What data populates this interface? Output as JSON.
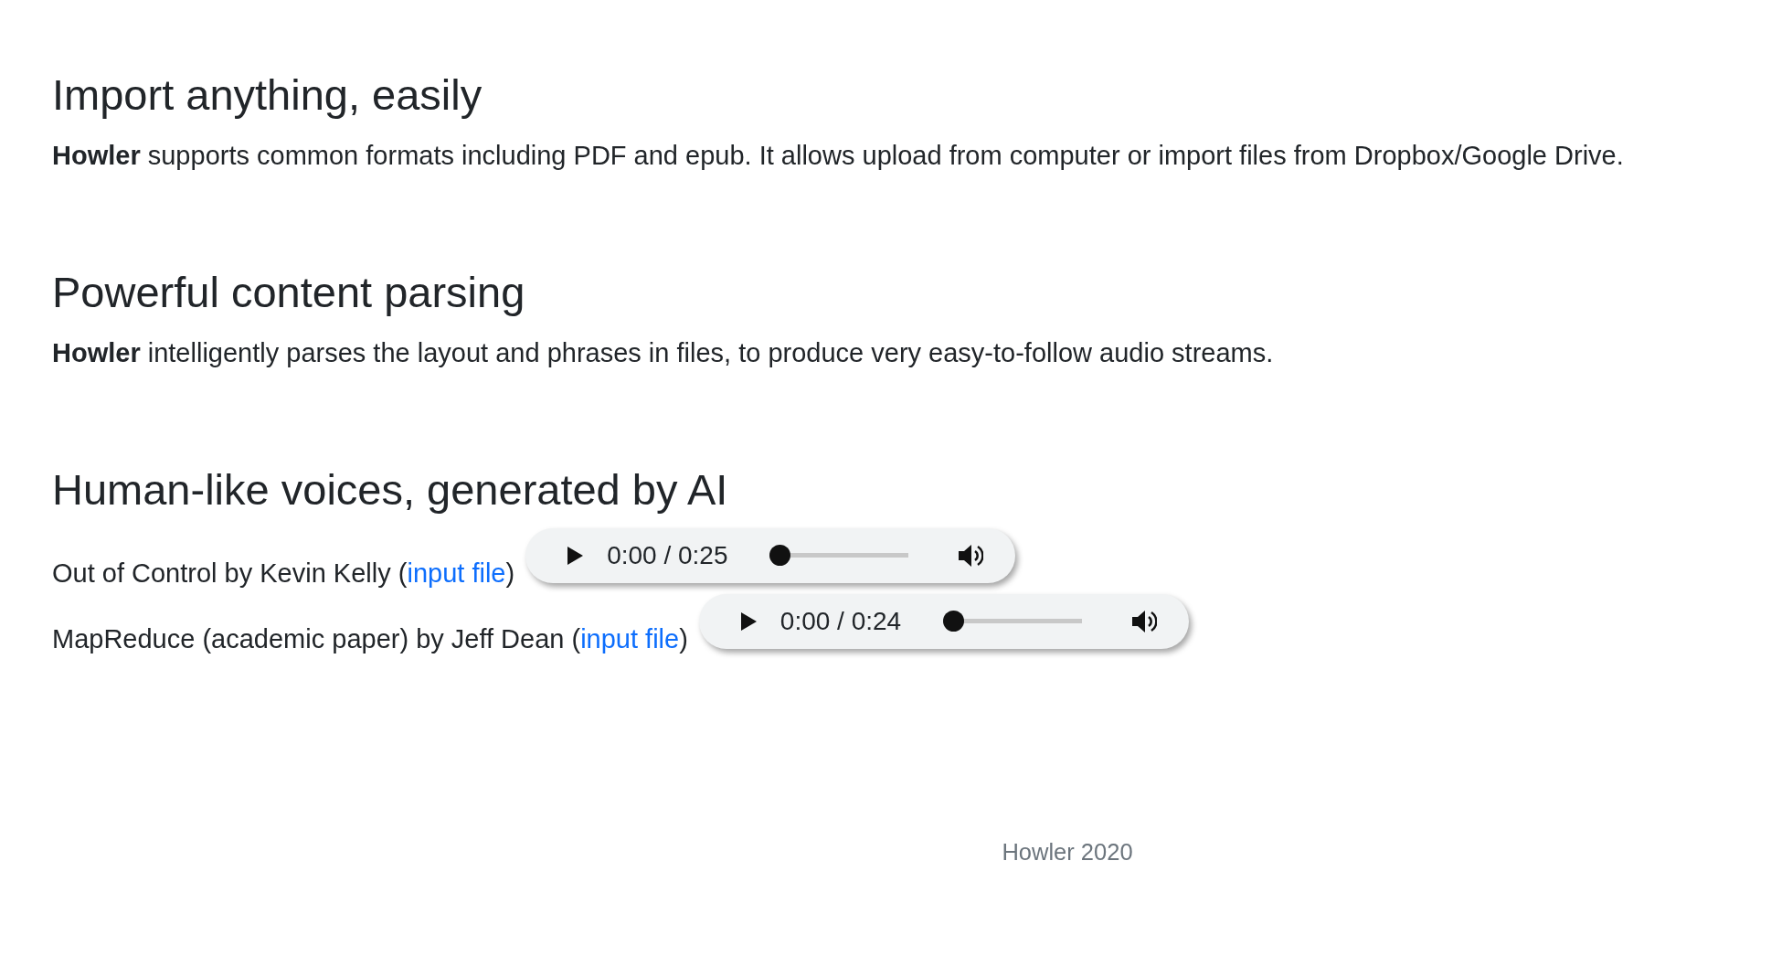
{
  "sections": [
    {
      "title": "Import anything, easily",
      "text": "**Howler** supports common formats including PDF and epub. It allows upload from computer or import files from Dropbox/Google Drive."
    },
    {
      "title": "Powerful content parsing",
      "text": "**Howler** intelligently parses the layout and phrases in files, to produce very easy-to-follow audio streams."
    },
    {
      "title": "Human-like voices, generated by AI",
      "samples": [
        {
          "label": "Out of Control by Kevin Kelly (",
          "link": "input file",
          "close": ")",
          "time": "0:00 / 0:25",
          "level": 0
        },
        {
          "label": "MapReduce (academic paper) by Jeff Dean (",
          "link": "input file",
          "close": ")",
          "time": "0:00 / 0:24",
          "level": 0
        }
      ]
    }
  ],
  "footer": "Howler 2020"
}
